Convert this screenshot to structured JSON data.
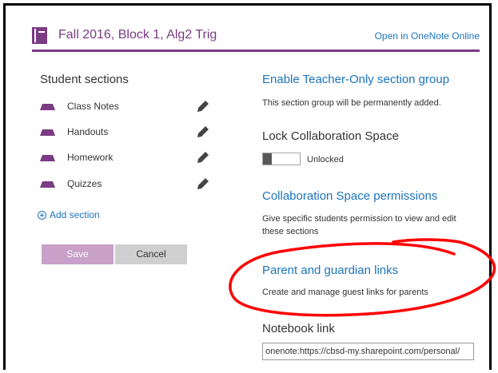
{
  "header": {
    "notebook_title": "Fall 2016, Block 1, Alg2 Trig",
    "open_online_link": "Open in OneNote Online"
  },
  "student_sections": {
    "heading": "Student sections",
    "items": [
      {
        "label": "Class Notes"
      },
      {
        "label": "Handouts"
      },
      {
        "label": "Homework"
      },
      {
        "label": "Quizzes"
      }
    ],
    "add_section_label": "Add section"
  },
  "buttons": {
    "save_label": "Save",
    "cancel_label": "Cancel"
  },
  "right_panel": {
    "teacher_only": {
      "title": "Enable Teacher-Only section group",
      "description": "This section group will be permanently added."
    },
    "lock_collab": {
      "title": "Lock Collaboration Space",
      "state_label": "Unlocked"
    },
    "collab_permissions": {
      "title": "Collaboration Space permissions",
      "description": "Give specific students permission to view and edit these sections"
    },
    "parent_links": {
      "title": "Parent and guardian links",
      "description": "Create and manage guest links for parents"
    },
    "notebook_link": {
      "title": "Notebook link",
      "value": "onenote:https://cbsd-my.sharepoint.com/personal/"
    }
  },
  "colors": {
    "accent_purple": "#7b3b85",
    "link_blue": "#1c74bb",
    "annotation_red": "#ff0000"
  },
  "icons": [
    "notebook-icon",
    "section-icon",
    "pencil-icon",
    "plus-circle-icon"
  ]
}
